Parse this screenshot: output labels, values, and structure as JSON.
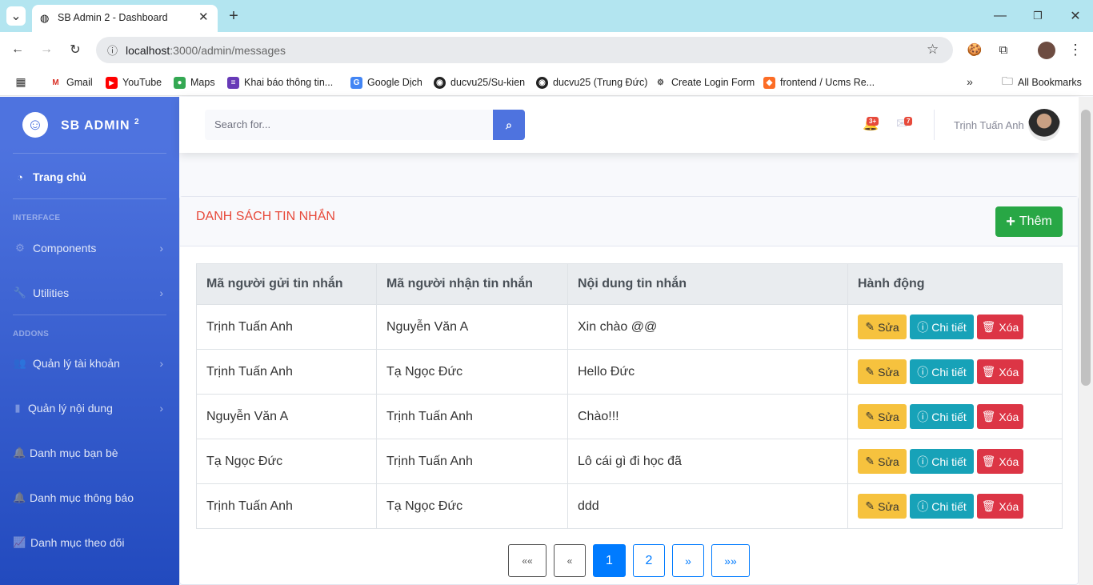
{
  "browser": {
    "tab_title": "SB Admin 2 - Dashboard",
    "url_host": "localhost",
    "url_path": ":3000/admin/messages",
    "bookmarks": [
      "Gmail",
      "YouTube",
      "Maps",
      "Khai báo thông tin...",
      "Google Dịch",
      "ducvu25/Su-kien",
      "ducvu25 (Trung Đức)",
      "Create Login Form",
      "frontend / Ucms Re..."
    ],
    "all_bookmarks": "All Bookmarks"
  },
  "sidebar": {
    "brand": "SB ADMIN",
    "brand_sup": "2",
    "home": "Trang chủ",
    "heading_interface": "INTERFACE",
    "components": "Components",
    "utilities": "Utilities",
    "heading_addons": "ADDONS",
    "items": [
      "Quản lý tài khoản",
      "Quản lý nội dung",
      "Danh mục bạn bè",
      "Danh mục thông báo",
      "Danh mục theo dõi"
    ]
  },
  "topbar": {
    "search_placeholder": "Search for...",
    "alerts_badge": "3+",
    "messages_badge": "7",
    "user_name": "Trịnh Tuấn Anh"
  },
  "card": {
    "title": "DANH SÁCH TIN NHẮN",
    "add_label": "Thêm"
  },
  "table": {
    "headers": [
      "Mã người gửi tin nhắn",
      "Mã người nhận tin nhắn",
      "Nội dung tin nhắn",
      "Hành động"
    ],
    "rows": [
      [
        "Trịnh Tuấn Anh",
        "Nguyễn Văn A",
        "Xin chào @@"
      ],
      [
        "Trịnh Tuấn Anh",
        "Tạ Ngọc Đức",
        "Hello Đức"
      ],
      [
        "Nguyễn Văn A",
        "Trịnh Tuấn Anh",
        "Chào!!!"
      ],
      [
        "Tạ Ngọc Đức",
        "Trịnh Tuấn Anh",
        "Lô cái gì đi học đã"
      ],
      [
        "Trịnh Tuấn Anh",
        "Tạ Ngọc Đức",
        "ddd"
      ]
    ],
    "edit_label": "Sửa",
    "detail_label": "Chi tiết",
    "delete_label": "Xóa"
  },
  "pagination": {
    "first": "««",
    "prev": "«",
    "pages": [
      "1",
      "2"
    ],
    "next": "»",
    "last": "»»",
    "active": "1"
  },
  "colors": {
    "primary": "#4e73df",
    "success": "#28a745",
    "warning": "#f6c23e",
    "info": "#17a2b8",
    "danger": "#dc3545",
    "title": "#e74a3b"
  }
}
